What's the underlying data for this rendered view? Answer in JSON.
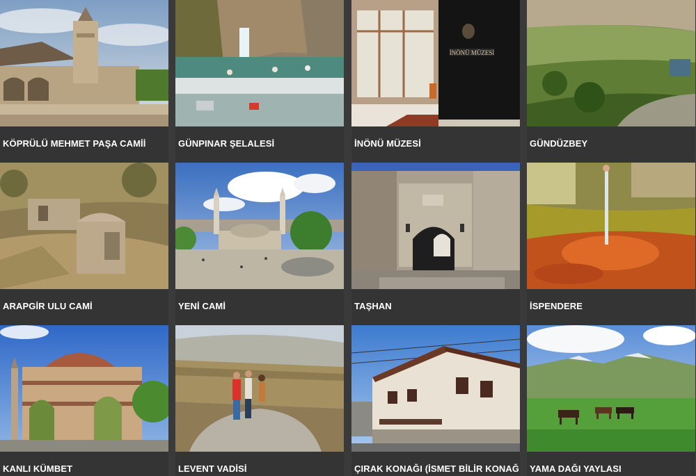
{
  "places": [
    {
      "name": "KÖPRÜLÜ MEHMET PAŞA CAMİİ",
      "image": "mosque-minaret-photo"
    },
    {
      "name": "GÜNPINAR ŞELALESİ",
      "image": "waterfall-photo"
    },
    {
      "name": "İNÖNÜ MÜZESİ",
      "image": "museum-entrance-photo"
    },
    {
      "name": "GÜNDÜZBEY",
      "image": "green-valley-aerial-photo"
    },
    {
      "name": "ARAPGİR ULU CAMİ",
      "image": "stone-ruins-photo"
    },
    {
      "name": "YENİ CAMİ",
      "image": "mosque-square-photo"
    },
    {
      "name": "TAŞHAN",
      "image": "stone-han-gate-photo"
    },
    {
      "name": "İSPENDERE",
      "image": "mineral-spring-photo"
    },
    {
      "name": "KANLI KÜMBET",
      "image": "domed-tomb-photo"
    },
    {
      "name": "LEVENT VADİSİ",
      "image": "canyon-hikers-photo"
    },
    {
      "name": "ÇIRAK KONAĞI (İSMET BİLİR KONAĞI)",
      "image": "ottoman-mansion-photo"
    },
    {
      "name": "YAMA DAĞI YAYLASI",
      "image": "plateau-horses-photo"
    }
  ],
  "colors": {
    "background": "#3a3a3a",
    "caption_text": "#ffffff"
  }
}
